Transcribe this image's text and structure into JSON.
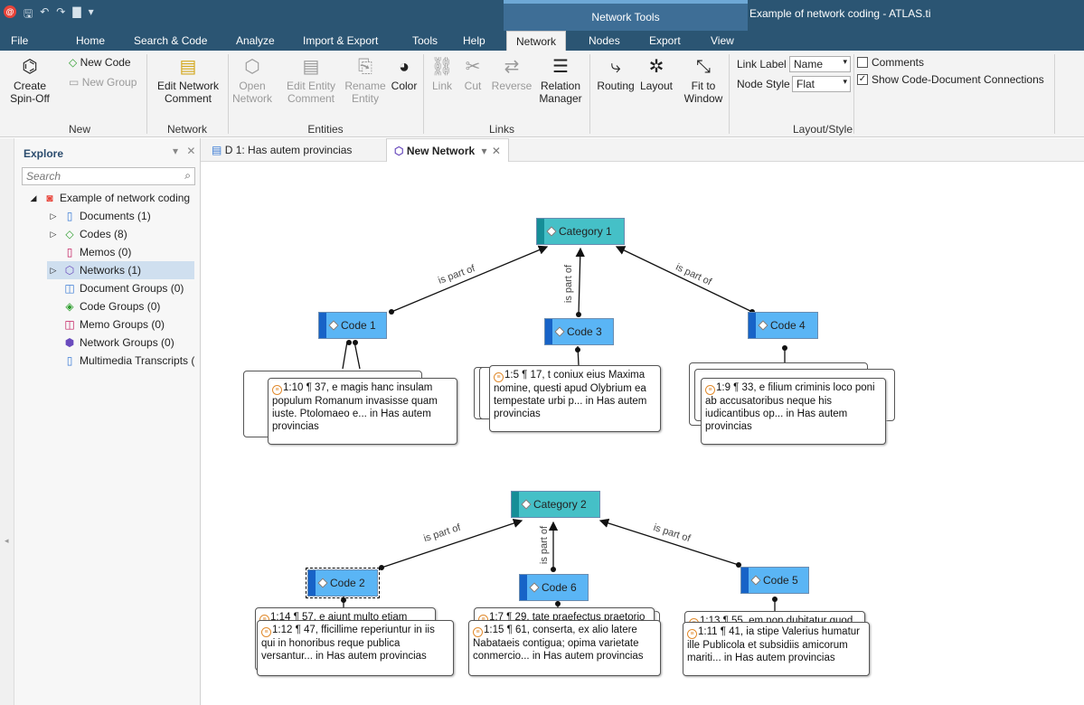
{
  "window": {
    "title": "Example of network coding - ATLAS.ti",
    "context_tools_label": "Network Tools"
  },
  "qat": {
    "logo": "@",
    "save": "🖫",
    "undo": "↶",
    "redo": "↷",
    "view": "▇",
    "more": "▾"
  },
  "ribbon_tabs": [
    "File",
    "Home",
    "Search & Code",
    "Analyze",
    "Import & Export",
    "Tools",
    "Help",
    "Network",
    "Nodes",
    "Export",
    "View"
  ],
  "active_tab": "Network",
  "ribbon": {
    "new_group": {
      "label": "New",
      "create_spin_off": "Create Spin-Off",
      "new_code": "New Code",
      "new_group": "New Group"
    },
    "network_group": {
      "label": "Network",
      "edit_comment": "Edit Network Comment"
    },
    "entities_group": {
      "label": "Entities",
      "open_network": "Open Network",
      "edit_entity_comment": "Edit Entity Comment",
      "rename_entity": "Rename Entity",
      "color": "Color"
    },
    "links_group": {
      "label": "Links",
      "link": "Link",
      "cut": "Cut",
      "reverse": "Reverse",
      "relation_manager": "Relation Manager"
    },
    "layout_group": {
      "label": "Layout/Style",
      "routing": "Routing",
      "layout": "Layout",
      "fit_to_window": "Fit to Window",
      "link_label_caption": "Link Label",
      "link_label_value": "Name",
      "node_style_caption": "Node Style",
      "node_style_value": "Flat",
      "comments": "Comments",
      "comments_checked": false,
      "show_connections": "Show Code-Document Connections",
      "show_connections_checked": true
    }
  },
  "explore": {
    "title": "Explore",
    "search_placeholder": "Search",
    "root": "Example of network coding",
    "items": [
      {
        "label": "Documents (1)",
        "icon": "document-icon",
        "expand": "▷"
      },
      {
        "label": "Codes (8)",
        "icon": "code-icon",
        "expand": "▷"
      },
      {
        "label": "Memos (0)",
        "icon": "memo-icon",
        "expand": ""
      },
      {
        "label": "Networks (1)",
        "icon": "network-icon",
        "expand": "▷"
      },
      {
        "label": "Document Groups (0)",
        "icon": "document-group-icon",
        "expand": ""
      },
      {
        "label": "Code Groups (0)",
        "icon": "code-group-icon",
        "expand": ""
      },
      {
        "label": "Memo Groups (0)",
        "icon": "memo-group-icon",
        "expand": ""
      },
      {
        "label": "Network Groups (0)",
        "icon": "network-group-icon",
        "expand": ""
      },
      {
        "label": "Multimedia Transcripts (",
        "icon": "transcript-icon",
        "expand": ""
      }
    ],
    "selected": "Networks (1)"
  },
  "doc_tabs": [
    {
      "label": "D 1: Has autem provincias"
    },
    {
      "label": "New Network"
    }
  ],
  "network": {
    "edge_label": "is part of",
    "categories": [
      {
        "id": "cat1",
        "label": "Category 1"
      },
      {
        "id": "cat2",
        "label": "Category 2"
      }
    ],
    "codes": [
      {
        "id": "c1",
        "label": "Code 1"
      },
      {
        "id": "c3",
        "label": "Code 3"
      },
      {
        "id": "c4",
        "label": "Code 4"
      },
      {
        "id": "c2",
        "label": "Code 2"
      },
      {
        "id": "c6",
        "label": "Code 6"
      },
      {
        "id": "c5",
        "label": "Code 5"
      }
    ],
    "quotes": [
      {
        "text": "1:10 ¶ 37, e magis hanc insulam populum Romanum invasisse quam iuste. Ptolomaeo e... in Has autem provincias"
      },
      {
        "text": "1:5 ¶ 17, t coniux eius Maxima nomine, questi apud Olybrium ea tempestate urbi p... in Has autem provincias"
      },
      {
        "text": "1:9 ¶ 33, e filium criminis loco poni ab accusatoribus neque his iudicantibus op... in Has autem provincias"
      },
      {
        "text": "1:14 ¶ 57, e aiunt multo etiam"
      },
      {
        "text": "1:12 ¶ 47, fficillime reperiuntur in iis qui in honoribus reque publica versantur... in Has autem provincias"
      },
      {
        "text": "1:7 ¶ 29, tate praefectus praetorio"
      },
      {
        "text": "1:15 ¶ 61, conserta, ex alio latere Nabataeis contigua; opima varietate conmercio... in Has autem provincias"
      },
      {
        "text": "1:13 ¶ 55, em non dubitatur quod"
      },
      {
        "text": "1:11 ¶ 41, ia stipe Valerius humatur ille Publicola et subsidiis amicorum mariti... in Has autem provincias"
      }
    ]
  }
}
